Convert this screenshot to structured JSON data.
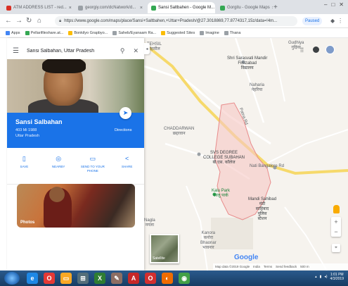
{
  "browser": {
    "tabs": [
      {
        "title": "ATM ADDRESS LIST - red...",
        "active": false,
        "fav_color": "#d93025"
      },
      {
        "title": "georgiy.com/dcNatwork/d...",
        "active": false,
        "fav_color": "#5f6368"
      },
      {
        "title": "Sansi Saltbahen - Google M...",
        "active": true,
        "fav_color": "#34a853"
      },
      {
        "title": "Gorgitu - Google Maps",
        "active": false,
        "fav_color": "#34a853"
      }
    ],
    "url": "https://www.google.com/maps/place/Sansi+Saltbahen,+Uttar+Pradesh/@27.3018869,77.8774317,15z/data=!4m...",
    "paused_label": "Paused",
    "bookmarks": [
      {
        "label": "Apps",
        "color": "#4285f4"
      },
      {
        "label": "Pellarifileshare.at...",
        "color": "#34a853"
      },
      {
        "label": "Bonkilyo Grapbyo...",
        "color": "#fbbc05"
      },
      {
        "label": "Saheb/Eyanaam Ra...",
        "color": "#5f6368"
      },
      {
        "label": "Suggested Sites",
        "color": "#fbbc05"
      },
      {
        "label": "Imagine",
        "color": "#5f6368"
      },
      {
        "label": "Thana",
        "color": "#5f6368"
      }
    ]
  },
  "panel": {
    "search_text": "Sansi Salbahan, Uttar Pradesh",
    "place_name": "Sansi Salbahan",
    "address_line1": "403 Mi 1988",
    "address_line2": "Uttar Pradesh",
    "directions_label": "Directions",
    "actions": [
      {
        "label": "Save",
        "icon": "bookmark-icon",
        "glyph": "▯"
      },
      {
        "label": "Nearby",
        "icon": "nearby-icon",
        "glyph": "◎"
      },
      {
        "label": "Send to your phone",
        "icon": "phone-icon",
        "glyph": "▭"
      },
      {
        "label": "Share",
        "icon": "share-icon",
        "glyph": "<"
      }
    ],
    "photos_label": "Photos"
  },
  "map": {
    "labels": {
      "top_village": "Gudhiya\nगुढ़िया",
      "top_left": "TEHSIL\nतहसील",
      "school": "Shri Sarasvati Mandir\nFirozabad\nविद्यालय",
      "mid_right": "Naharia\nनेहरिया",
      "road_label": "Patna Rd",
      "chaddar": "CHADDARWAN\nछद्दरवान",
      "college": "SVS DEGREE\nCOLLEGE SUBAHAN\nबी.एस. कॉलेज",
      "highway_label": "Nati Bangalore Rd",
      "park": "Kalu Park\nकालू पार्क",
      "mandi": "Mandi Sahibad\nमंडी\nसाहिबाद\nपुलिस\nस्टेशन",
      "bottom_area": "Kanora\nकनोरा\nBhaonar\nभावनार",
      "nala": "Nagla\nनगला"
    },
    "satellite_label": "Satellite",
    "google_logo": "Google",
    "attribution": [
      "Map data ©2019 Google",
      "India",
      "Terms",
      "Send feedback",
      "500 m"
    ],
    "colors": {
      "boundary": "#e88b8b",
      "fill": "#f7c8c4",
      "road_major": "#f6d96b",
      "road_minor": "#ffffff"
    }
  },
  "taskbar": {
    "apps": [
      {
        "name": "ie",
        "color": "#1e88e5",
        "glyph": "e"
      },
      {
        "name": "opera",
        "color": "#e53935",
        "glyph": "O"
      },
      {
        "name": "explorer",
        "color": "#f9a825",
        "glyph": "▭"
      },
      {
        "name": "network",
        "color": "#546e7a",
        "glyph": "⊞"
      },
      {
        "name": "excel",
        "color": "#2e7d32",
        "glyph": "X"
      },
      {
        "name": "paint",
        "color": "#8d6e63",
        "glyph": "✎"
      },
      {
        "name": "pdf",
        "color": "#c62828",
        "glyph": "A"
      },
      {
        "name": "opera2",
        "color": "#d32f2f",
        "glyph": "O"
      },
      {
        "name": "firefox",
        "color": "#ef6c00",
        "glyph": "◐"
      },
      {
        "name": "chrome",
        "color": "#43a047",
        "glyph": "◉"
      }
    ],
    "time": "1:01 PM",
    "date": "4/3/2019"
  }
}
